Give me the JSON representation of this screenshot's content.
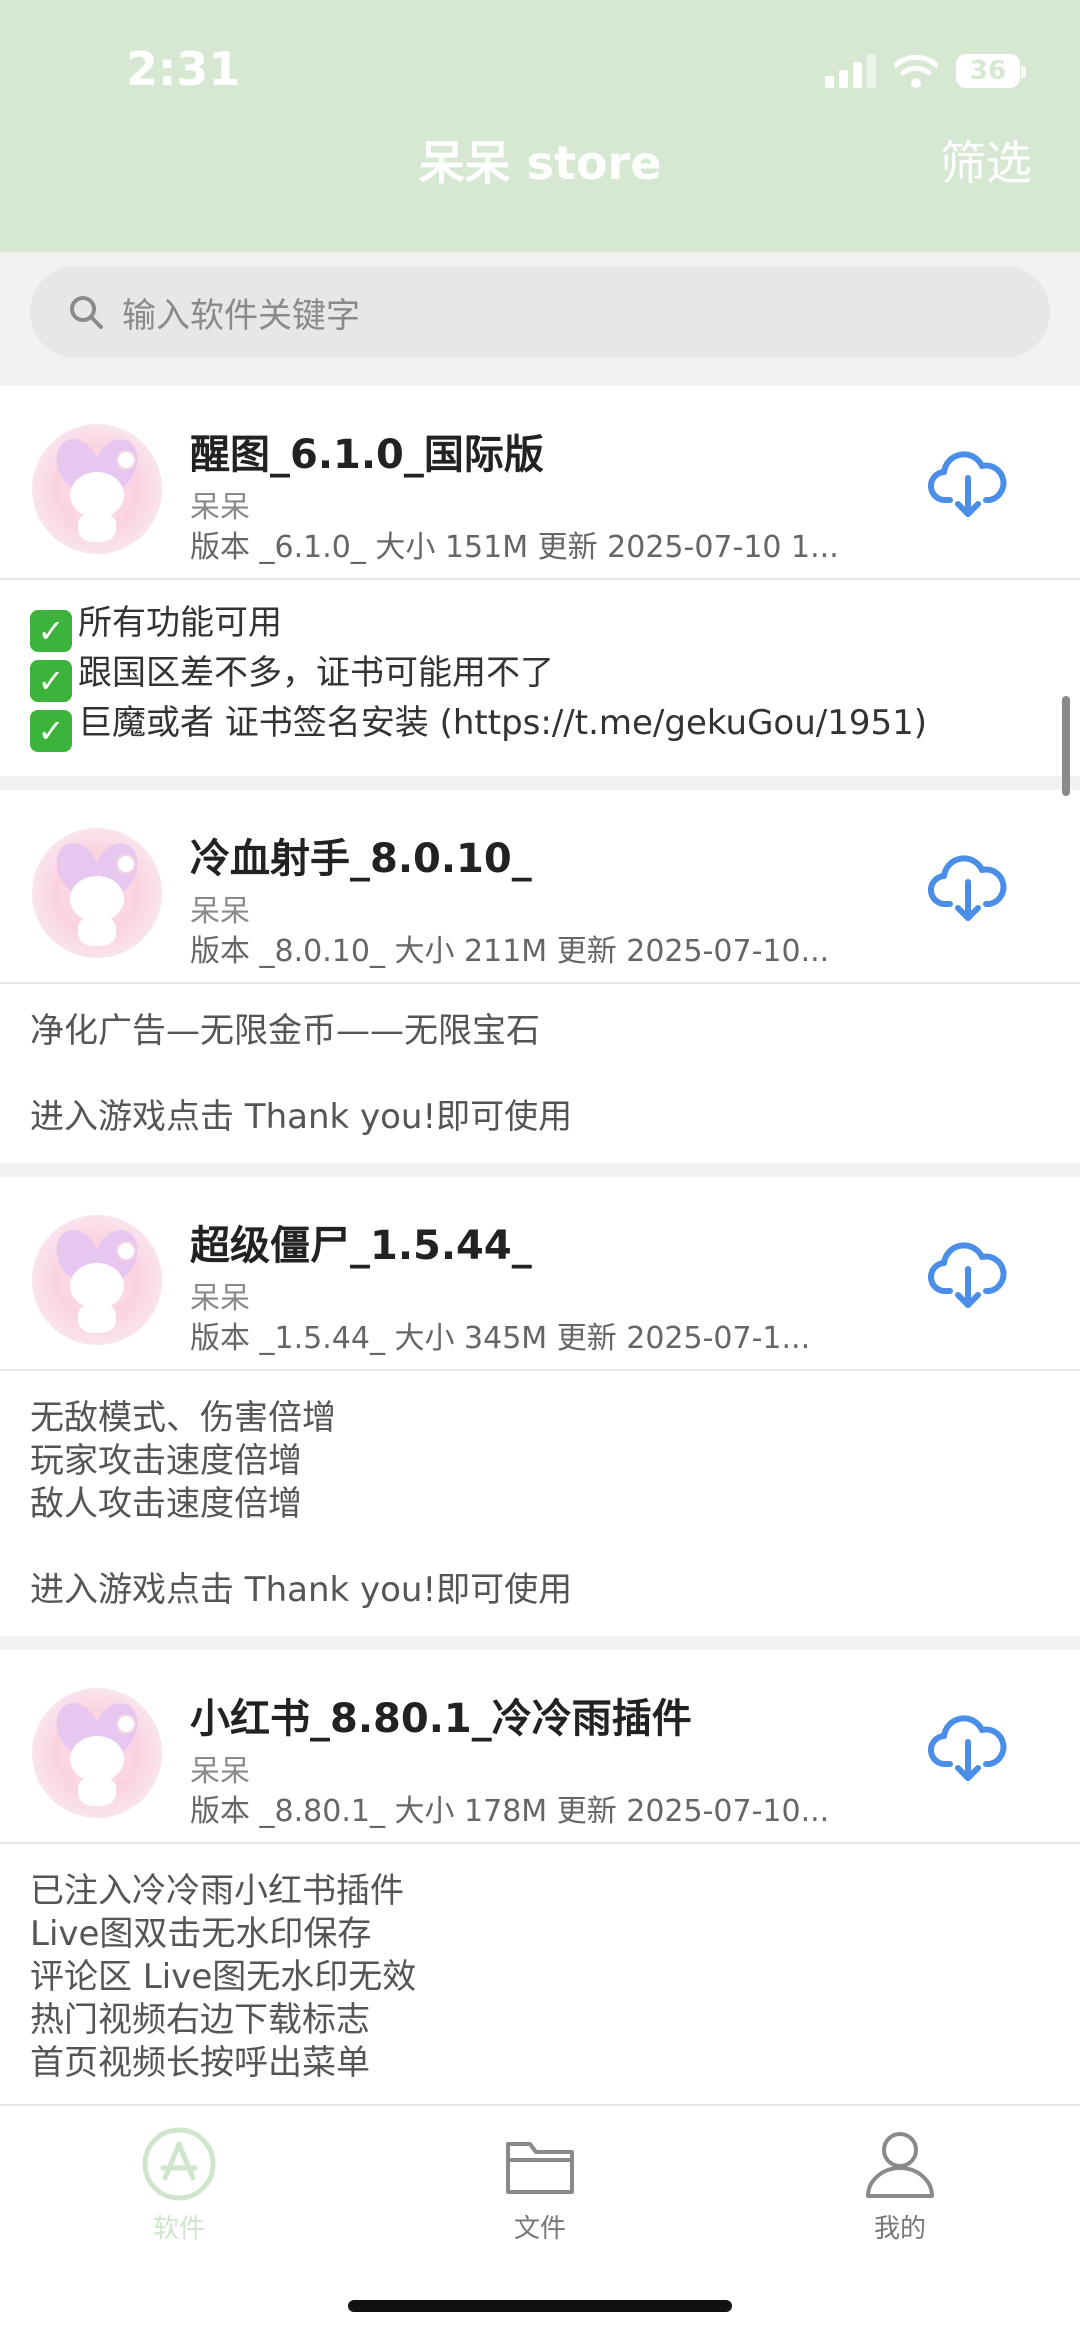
{
  "status": {
    "time": "2:31",
    "battery": "36"
  },
  "header": {
    "title": "呆呆 store",
    "filter_label": "筛选"
  },
  "search": {
    "placeholder": "输入软件关键字"
  },
  "apps": [
    {
      "name": "醒图_6.1.0_国际版",
      "author": "呆呆",
      "meta": "版本 _6.1.0_  大小 151M  更新 2025-07-10 1...",
      "checks": [
        "所有功能可用",
        "跟国区差不多，证书可能用不了",
        "巨魔或者 证书签名安装 (https://t.me/gekuGou/1951)"
      ]
    },
    {
      "name": "冷血射手_8.0.10_",
      "author": "呆呆",
      "meta": "版本 _8.0.10_  大小 211M  更新 2025-07-10...",
      "description": "净化广告—无限金币——无限宝石\n\n进入游戏点击 Thank you!即可使用"
    },
    {
      "name": "超级僵尸_1.5.44_",
      "author": "呆呆",
      "meta": "版本 _1.5.44_  大小 345M  更新 2025-07-1...",
      "description": "无敌模式、伤害倍增\n玩家攻击速度倍增\n敌人攻击速度倍增\n\n进入游戏点击 Thank you!即可使用"
    },
    {
      "name": "小红书_8.80.1_冷冷雨插件",
      "author": "呆呆",
      "meta": "版本 _8.80.1_  大小 178M  更新 2025-07-10...",
      "description": "已注入冷冷雨小红书插件\n Live图双击无水印保存\n评论区 Live图无水印无效\n热门视频右边下载标志\n首页视频长按呼出菜单"
    }
  ],
  "tabs": [
    {
      "label": "软件",
      "icon": "app-store-icon",
      "active": true
    },
    {
      "label": "文件",
      "icon": "folder-icon",
      "active": false
    },
    {
      "label": "我的",
      "icon": "person-icon",
      "active": false
    }
  ],
  "colors": {
    "header_bg": "#d6e8d2",
    "accent_blue": "#4a8ee8",
    "active_tab": "#cfe6cc",
    "inactive_tab": "#777777"
  }
}
